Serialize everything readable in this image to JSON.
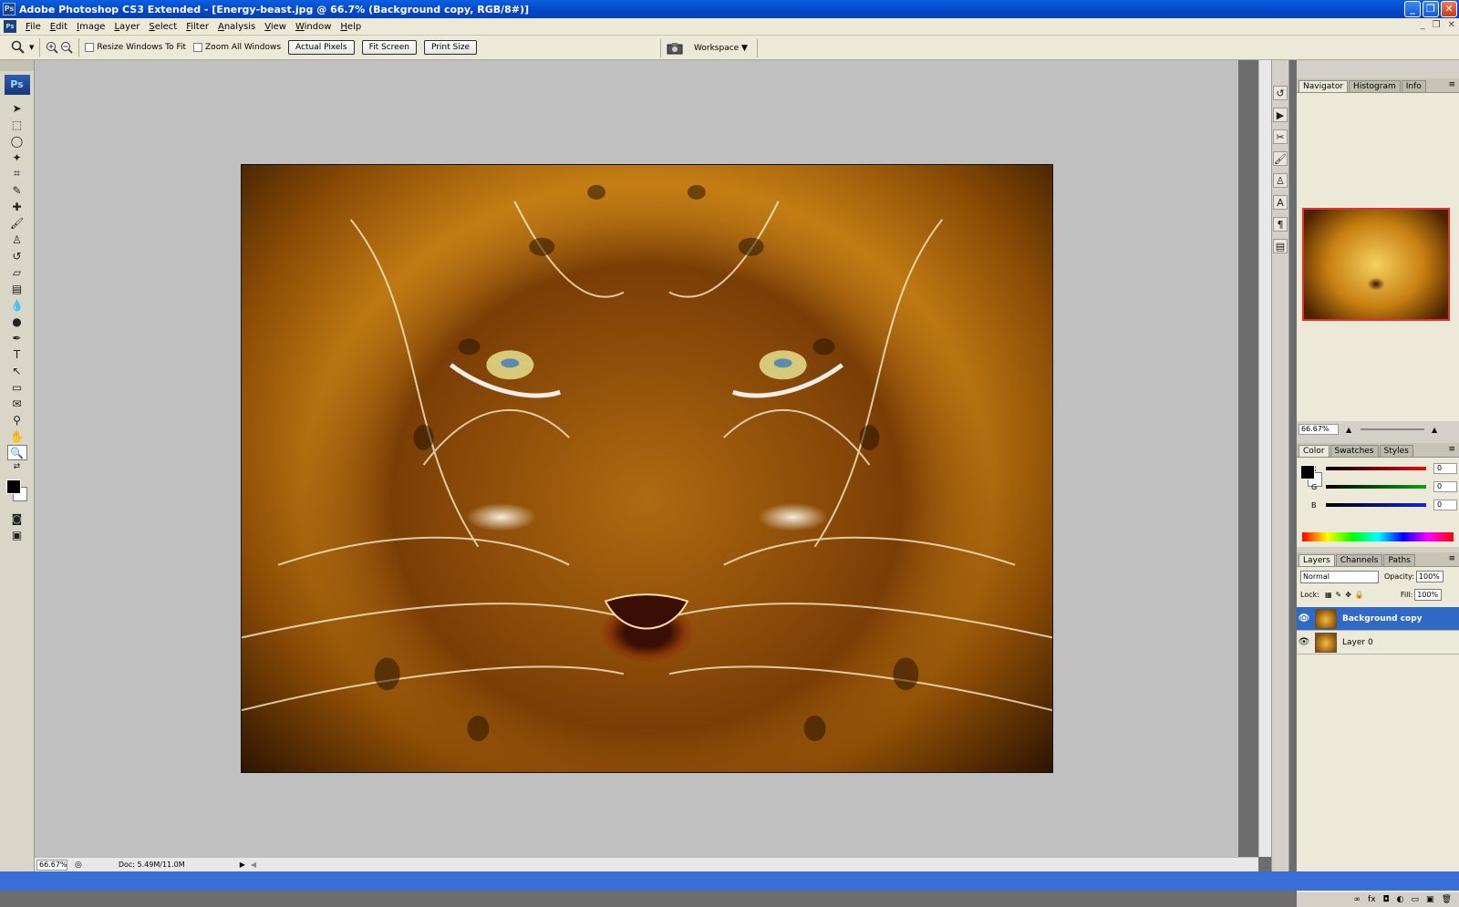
{
  "window": {
    "title": "Adobe Photoshop CS3 Extended - [Energy-beast.jpg @ 66.7% (Background copy, RGB/8#)]",
    "logo": "Ps",
    "minimize": "_",
    "restore": "❐",
    "close": "✕"
  },
  "menu": [
    "File",
    "Edit",
    "Image",
    "Layer",
    "Select",
    "Filter",
    "Analysis",
    "View",
    "Window",
    "Help"
  ],
  "doc_controls": {
    "min": "_",
    "restore": "❐",
    "close": "✕"
  },
  "options": {
    "resize_windows": "Resize Windows To Fit",
    "zoom_all": "Zoom All Windows",
    "actual_pixels": "Actual Pixels",
    "fit_screen": "Fit Screen",
    "print_size": "Print Size",
    "workspace": "Workspace ▼"
  },
  "toolbox": {
    "badge": "Ps"
  },
  "status": {
    "zoom": "66.67%",
    "doc": "Doc: 5.49M/11.0M"
  },
  "navigator": {
    "tabs": [
      "Navigator",
      "Histogram",
      "Info"
    ],
    "zoom": "66.67%"
  },
  "color": {
    "tabs": [
      "Color",
      "Swatches",
      "Styles"
    ],
    "channels": [
      {
        "label": "R",
        "value": "0",
        "color": "#e01010"
      },
      {
        "label": "G",
        "value": "0",
        "color": "#10a010"
      },
      {
        "label": "B",
        "value": "0",
        "color": "#1020e0"
      }
    ]
  },
  "layers": {
    "tabs": [
      "Layers",
      "Channels",
      "Paths"
    ],
    "blend_mode": "Normal",
    "opacity_label": "Opacity:",
    "opacity": "100%",
    "lock_label": "Lock:",
    "fill_label": "Fill:",
    "fill": "100%",
    "items": [
      {
        "name": "Background copy",
        "selected": true
      },
      {
        "name": "Layer 0",
        "selected": false
      }
    ]
  }
}
